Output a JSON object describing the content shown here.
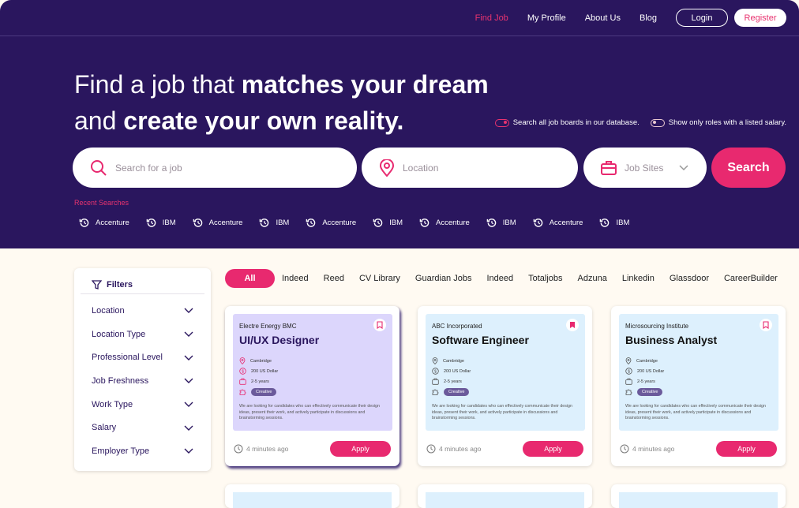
{
  "nav": {
    "items": [
      "Find Job",
      "My Profile",
      "About Us",
      "Blog"
    ],
    "login": "Login",
    "register": "Register"
  },
  "hero": {
    "line1_light": "Find a job that ",
    "line1_bold": "matches your dream",
    "line2_light": "and ",
    "line2_bold": "create your own reality."
  },
  "toggles": [
    {
      "label": "Search all job boards in our database.",
      "on": true
    },
    {
      "label": "Show only roles with a listed salary.",
      "on": false
    }
  ],
  "search": {
    "job_placeholder": "Search for a job",
    "location_placeholder": "Location",
    "job_sites": "Job Sites",
    "button": "Search"
  },
  "recent": {
    "label": "Recent Searches",
    "items": [
      "Accenture",
      "IBM",
      "Accenture",
      "IBM",
      "Accenture",
      "IBM",
      "Accenture",
      "IBM",
      "Accenture",
      "IBM"
    ]
  },
  "filters": {
    "title": "Filters",
    "items": [
      "Location",
      "Location Type",
      "Professional Level",
      "Job Freshness",
      "Work Type",
      "Salary",
      "Employer Type"
    ]
  },
  "tabs": [
    "All",
    "Indeed",
    "Reed",
    "CV Library",
    "Guardian Jobs",
    "Indeed",
    "Totaljobs",
    "Adzuna",
    "Linkedin",
    "Glassdoor",
    "CareerBuilder"
  ],
  "colors": {
    "primary": "#2a165e",
    "accent": "#e8296f"
  },
  "cards": [
    {
      "company": "Electre Energy BMC",
      "title": "UI/UX Designer",
      "location": "Cambridge",
      "salary": "200 US Dollar",
      "experience": "2-5 years",
      "tag": "Creative",
      "description": "We are looking for candidates who can effectively communicate their design ideas, present their work, and actively participate in discussions and brainstorming sessions.",
      "posted": "4 minutes ago",
      "apply": "Apply",
      "bookmarked": false
    },
    {
      "company": "ABC Incorporated",
      "title": "Software Engineer",
      "location": "Cambridge",
      "salary": "200 US Dollar",
      "experience": "2-5 years",
      "tag": "Creative",
      "description": "We are looking for candidates who can effectively communicate their design ideas, present their work, and actively participate in discussions and brainstorming sessions.",
      "posted": "4 minutes ago",
      "apply": "Apply",
      "bookmarked": true
    },
    {
      "company": "Microsourcing Institute",
      "title": "Business Analyst",
      "location": "Cambridge",
      "salary": "200 US Dollar",
      "experience": "2-5 years",
      "tag": "Creative",
      "description": "We are looking for candidates who can effectively communicate their design ideas, present their work, and actively participate in discussions and brainstorming sessions.",
      "posted": "4 minutes ago",
      "apply": "Apply",
      "bookmarked": false
    }
  ]
}
